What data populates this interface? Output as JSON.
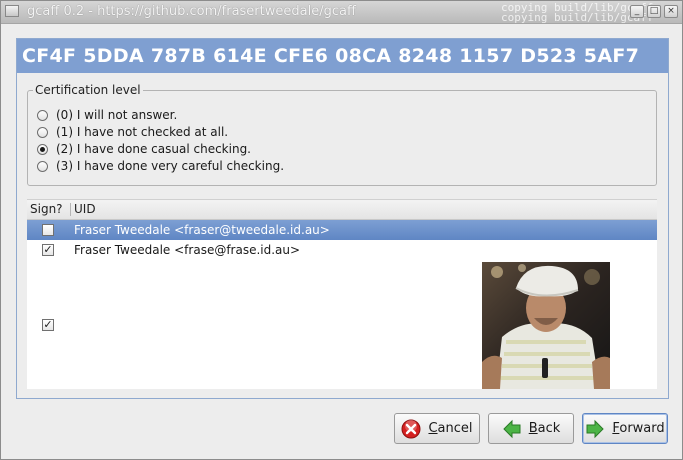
{
  "window": {
    "title": "gcaff 0.2 - https://github.com/frasertweedale/gcaff",
    "background_text_1": "copying build/lib/gcaff",
    "background_text_2": "copying build/lib/gcaff",
    "controls": {
      "minimize": "_",
      "maximize": "□",
      "close": "×"
    }
  },
  "key": {
    "fingerprint": "CF4F 5DDA 787B 614E CFE6 08CA 8248 1157 D523 5AF7"
  },
  "certification": {
    "legend": "Certification level",
    "options": [
      {
        "label": "(0) I will not answer.",
        "selected": false
      },
      {
        "label": "(1) I have not checked at all.",
        "selected": false
      },
      {
        "label": "(2) I have done casual checking.",
        "selected": true
      },
      {
        "label": "(3) I have done very careful checking.",
        "selected": false
      }
    ]
  },
  "uid_table": {
    "columns": [
      "Sign?",
      "UID"
    ],
    "rows": [
      {
        "checked": false,
        "uid": "Fraser Tweedale <fraser@tweedale.id.au>",
        "selected": true
      },
      {
        "checked": true,
        "uid": "Fraser Tweedale <frase@frase.id.au>",
        "selected": false
      },
      {
        "checked": true,
        "uid": "",
        "type": "photo-uid",
        "selected": false
      }
    ]
  },
  "buttons": {
    "cancel": {
      "label": "Cancel",
      "mnemonic": "C",
      "rest": "ancel",
      "icon": "cancel-icon"
    },
    "back": {
      "label": "Back",
      "mnemonic": "B",
      "rest": "ack",
      "icon": "back-arrow-icon"
    },
    "forward": {
      "label": "Forward",
      "mnemonic": "F",
      "rest": "orward",
      "icon": "forward-arrow-icon"
    }
  },
  "colors": {
    "accent": "#7f9fd1",
    "selection": "#6a8fca",
    "cancel_icon": "#d42020",
    "arrow_icon": "#3ea83a"
  }
}
